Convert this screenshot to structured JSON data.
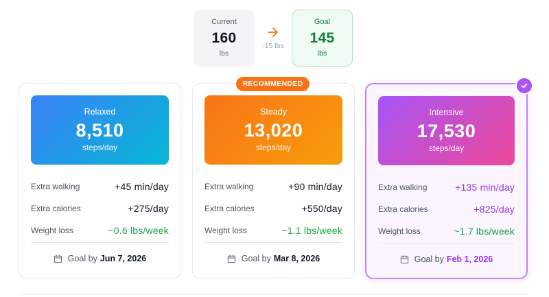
{
  "weight": {
    "current": {
      "label": "Current",
      "value": "160",
      "unit": "lbs"
    },
    "goal": {
      "label": "Goal",
      "value": "145",
      "unit": "lbs"
    },
    "difference": "-15 lbs"
  },
  "badge": "RECOMMENDED",
  "colors": {
    "accent_orange": "#f97316",
    "accent_purple": "#a855f7",
    "positive_green": "#16a34a"
  },
  "plans": [
    {
      "name": "Relaxed",
      "steps": "8,510",
      "steps_unit": "steps/day",
      "stats": [
        {
          "label": "Extra walking",
          "value": "+45 min/day"
        },
        {
          "label": "Extra calories",
          "value": "+275/day"
        },
        {
          "label": "Weight loss",
          "value": "~0.6 lbs/week"
        }
      ],
      "goal_prefix": "Goal by",
      "goal_date": "Jun 7, 2026"
    },
    {
      "name": "Steady",
      "steps": "13,020",
      "steps_unit": "steps/day",
      "stats": [
        {
          "label": "Extra walking",
          "value": "+90 min/day"
        },
        {
          "label": "Extra calories",
          "value": "+550/day"
        },
        {
          "label": "Weight loss",
          "value": "~1.1 lbs/week"
        }
      ],
      "goal_prefix": "Goal by",
      "goal_date": "Mar 8, 2026"
    },
    {
      "name": "Intensive",
      "steps": "17,530",
      "steps_unit": "steps/day",
      "stats": [
        {
          "label": "Extra walking",
          "value": "+135 min/day"
        },
        {
          "label": "Extra calories",
          "value": "+825/day"
        },
        {
          "label": "Weight loss",
          "value": "~1.7 lbs/week"
        }
      ],
      "goal_prefix": "Goal by",
      "goal_date": "Feb 1, 2026",
      "selected": true
    }
  ]
}
